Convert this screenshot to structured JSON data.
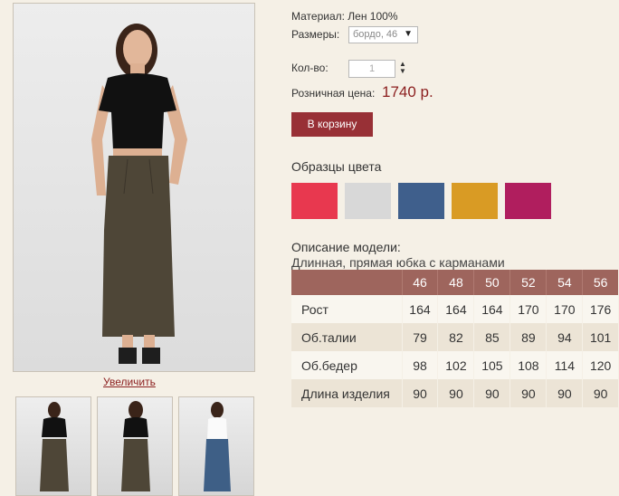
{
  "product": {
    "material": "Материал: Лен 100%",
    "sizes_label": "Размеры:",
    "size_selected": "бордо, 46",
    "qty_label": "Кол-во:",
    "qty_value": "1",
    "price_label": "Розничная цена:",
    "price": "1740 р.",
    "cart_button": "В корзину"
  },
  "gallery": {
    "zoom_link": "Увеличить",
    "thumbnails": [
      "front-black-top",
      "back-black-top",
      "front-white-top"
    ]
  },
  "colors": {
    "title": "Образцы цвета",
    "swatches": [
      "#e8384f",
      "#d8d8d8",
      "#3f5f8c",
      "#d99b24",
      "#b01e5e"
    ]
  },
  "description": {
    "title": "Описание модели:",
    "subtitle": "Длинная, прямая юбка с карманами"
  },
  "size_table": {
    "headers": [
      "",
      "46",
      "48",
      "50",
      "52",
      "54",
      "56"
    ],
    "rows": [
      {
        "label": "Рост",
        "values": [
          "164",
          "164",
          "164",
          "170",
          "170",
          "176"
        ]
      },
      {
        "label": "Об.талии",
        "values": [
          "79",
          "82",
          "85",
          "89",
          "94",
          "101"
        ]
      },
      {
        "label": "Об.бедер",
        "values": [
          "98",
          "102",
          "105",
          "108",
          "114",
          "120"
        ]
      },
      {
        "label": "Длина изделия",
        "values": [
          "90",
          "90",
          "90",
          "90",
          "90",
          "90"
        ]
      }
    ]
  },
  "style": {
    "accent": "#983036",
    "price_color": "#8b1e1e",
    "table_header": "#9e655d",
    "background": "#f5f0e6"
  }
}
